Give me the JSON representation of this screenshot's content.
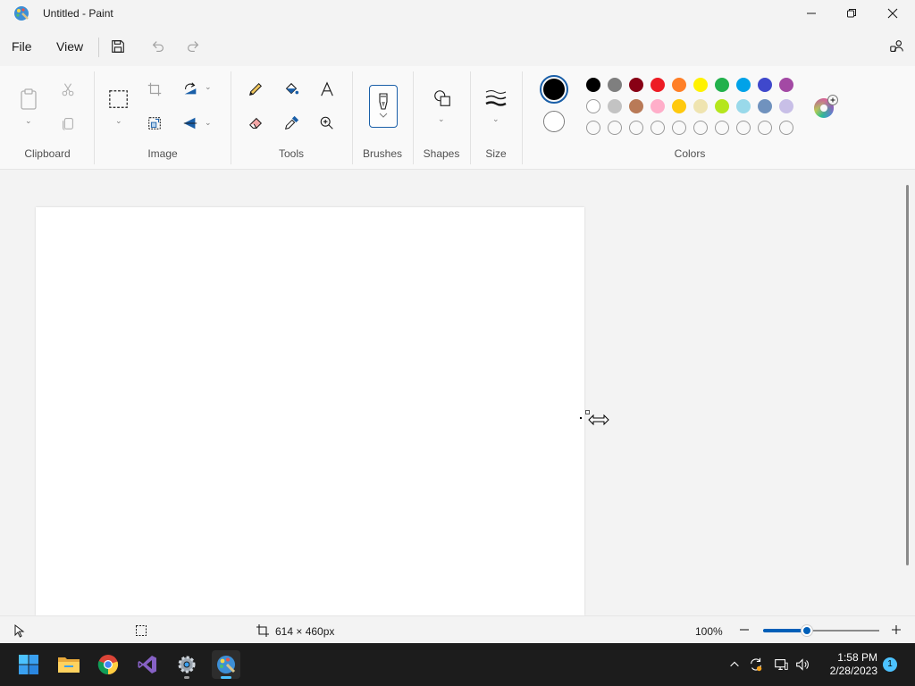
{
  "window": {
    "title": "Untitled - Paint"
  },
  "menu": {
    "file": "File",
    "view": "View"
  },
  "ribbon": {
    "groups": {
      "clipboard": "Clipboard",
      "image": "Image",
      "tools": "Tools",
      "brushes": "Brushes",
      "shapes": "Shapes",
      "size": "Size",
      "colors": "Colors"
    },
    "primary_color": "#000000",
    "secondary_color": "#ffffff",
    "palette_row1": [
      "#000000",
      "#7f7f7f",
      "#880015",
      "#ed1c24",
      "#ff7f27",
      "#fff200",
      "#22b14c",
      "#00a2e8",
      "#3f48cc",
      "#a349a4"
    ],
    "palette_row2": [
      "#ffffff",
      "#c3c3c3",
      "#b97a57",
      "#ffaec9",
      "#ffc90e",
      "#efe4b0",
      "#b5e61d",
      "#99d9ea",
      "#7092be",
      "#c8bfe7"
    ]
  },
  "status": {
    "canvas_size": "614 × 460px",
    "zoom": "100%",
    "zoom_fraction": 0.38
  },
  "taskbar": {
    "time": "1:58 PM",
    "date": "2/28/2023",
    "notifications": "1"
  }
}
